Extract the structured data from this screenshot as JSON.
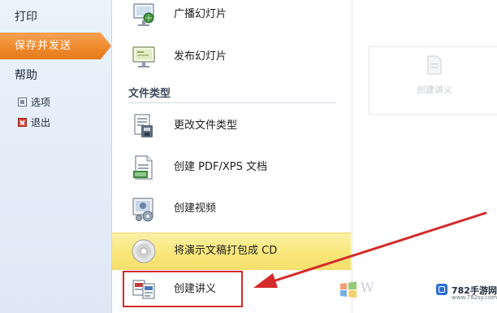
{
  "left_nav": {
    "print": "打印",
    "active_item": "保存并发送",
    "help": "帮助",
    "options": "选项",
    "exit": "退出"
  },
  "commands_top": [
    {
      "label": "广播幻灯片",
      "icon": "broadcast-icon"
    },
    {
      "label": "发布幻灯片",
      "icon": "publish-slides-icon"
    }
  ],
  "file_types": {
    "heading": "文件类型",
    "items": [
      {
        "label": "更改文件类型",
        "icon": "change-file-type-icon"
      },
      {
        "label": "创建 PDF/XPS 文档",
        "icon": "pdf-xps-icon"
      },
      {
        "label": "创建视频",
        "icon": "video-icon"
      },
      {
        "label": "将演示文稿打包成 CD",
        "icon": "cd-icon",
        "highlighted": true
      },
      {
        "label": "创建讲义",
        "icon": "handout-icon",
        "boxed": true
      }
    ]
  },
  "right_panel": {
    "thumb_label": "创建讲义"
  },
  "watermark": {
    "win_text": "W",
    "site_name": "782手游网",
    "site_url": "www.782sy.com"
  },
  "colors": {
    "accent_orange": "#ef8a2c",
    "highlight_yellow": "#f9e87c",
    "annotation_red": "#d42a2a"
  }
}
